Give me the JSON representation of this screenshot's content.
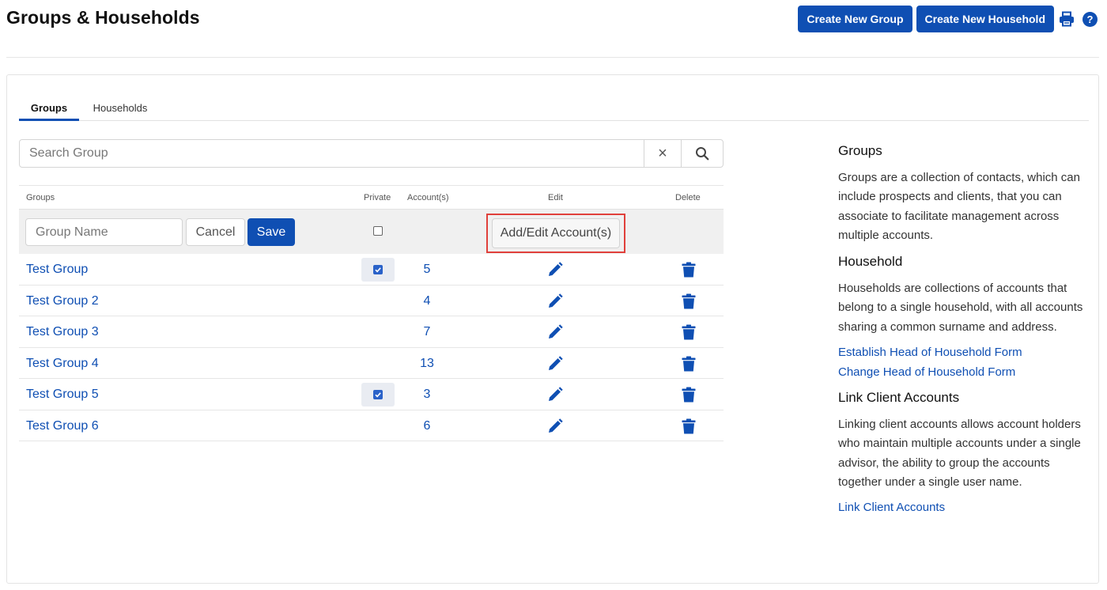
{
  "header": {
    "title": "Groups & Households",
    "create_group_label": "Create New Group",
    "create_household_label": "Create New Household",
    "help_label": "?"
  },
  "tabs": [
    {
      "label": "Groups",
      "active": true
    },
    {
      "label": "Households",
      "active": false
    }
  ],
  "search": {
    "placeholder": "Search Group",
    "value": "",
    "clear_label": "×"
  },
  "table": {
    "columns": {
      "groups": "Groups",
      "private": "Private",
      "accounts": "Account(s)",
      "edit": "Edit",
      "delete": "Delete"
    },
    "edit_row": {
      "name_placeholder": "Group Name",
      "name_value": "",
      "cancel_label": "Cancel",
      "save_label": "Save",
      "private_checked": false,
      "add_edit_label": "Add/Edit Account(s)"
    },
    "rows": [
      {
        "name": "Test Group",
        "private": true,
        "accounts": "5"
      },
      {
        "name": "Test Group 2",
        "private": false,
        "accounts": "4"
      },
      {
        "name": "Test Group 3",
        "private": false,
        "accounts": "7"
      },
      {
        "name": "Test Group 4",
        "private": false,
        "accounts": "13"
      },
      {
        "name": "Test Group 5",
        "private": true,
        "accounts": "3"
      },
      {
        "name": "Test Group 6",
        "private": false,
        "accounts": "6"
      }
    ]
  },
  "info": {
    "groups_title": "Groups",
    "groups_text": "Groups are a collection of contacts, which can include prospects and clients, that you can associate to facilitate management across multiple accounts.",
    "household_title": "Household",
    "household_text": "Households are collections of accounts that belong to a single household, with all accounts sharing a common surname and address.",
    "household_link_1": "Establish Head of Household Form",
    "household_link_2": "Change Head of Household Form",
    "link_title": "Link Client Accounts",
    "link_text": "Linking client accounts allows account holders who maintain multiple accounts under a single advisor, the ability to group the accounts together under a single user name.",
    "link_link": "Link Client Accounts"
  },
  "colors": {
    "primary": "#0f4fb3",
    "highlight_border": "#e0403b",
    "edit_row_bg": "#f0f0f0"
  },
  "icons": {
    "print": "print-icon",
    "help": "help-icon",
    "search": "search-icon",
    "clear": "close-icon",
    "edit": "pencil-icon",
    "delete": "trash-icon",
    "checked": "checkbox-checked-icon"
  }
}
